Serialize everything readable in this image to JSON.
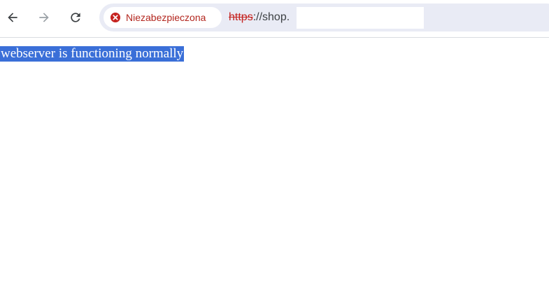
{
  "browser": {
    "nav": {
      "back_icon": "arrow-left-icon",
      "forward_icon": "arrow-right-icon",
      "reload_icon": "reload-icon"
    },
    "security_chip": {
      "icon": "error-circle-icon",
      "label": "Niezabezpieczona",
      "color": "#b3261e"
    },
    "address_bar": {
      "scheme": "https",
      "rest": "://shop."
    }
  },
  "page": {
    "body_text": "webserver is functioning normally",
    "selection_color": "#3a6fd8"
  }
}
